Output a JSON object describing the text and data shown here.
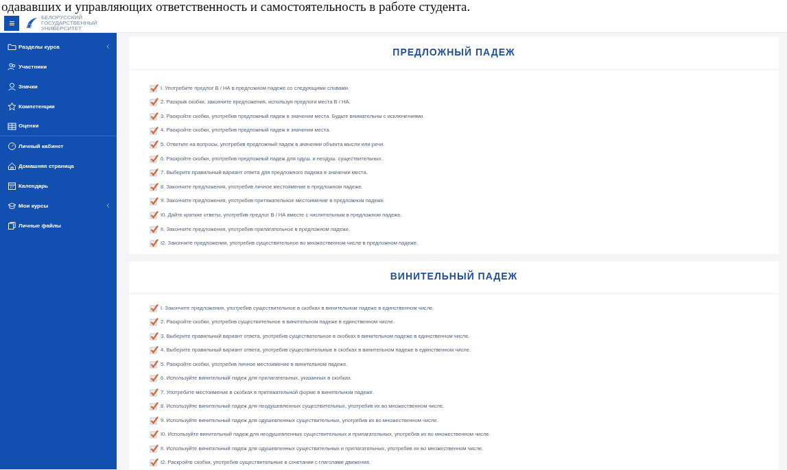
{
  "top_text": "одававших и управляющих ответственность и самостоятельность в работе студента.",
  "header": {
    "menu_glyph": "≡",
    "logo_lines": [
      "БЕЛОРУССКИЙ",
      "ГОСУДАРСТВЕННЫЙ",
      "УНИВЕРСИТЕТ"
    ]
  },
  "sidebar": {
    "items": [
      {
        "label": "Разделы курса",
        "expandable": true,
        "divider_after": false
      },
      {
        "label": "Участники",
        "expandable": false,
        "divider_after": false
      },
      {
        "label": "Значки",
        "expandable": false,
        "divider_after": false
      },
      {
        "label": "Компетенции",
        "expandable": false,
        "divider_after": false
      },
      {
        "label": "Оценки",
        "expandable": false,
        "divider_after": true
      },
      {
        "label": "Личный кабинет",
        "expandable": false,
        "divider_after": false
      },
      {
        "label": "Домашняя страница",
        "expandable": false,
        "divider_after": false
      },
      {
        "label": "Календарь",
        "expandable": false,
        "divider_after": false
      },
      {
        "label": "Мои курсы",
        "expandable": true,
        "divider_after": false
      },
      {
        "label": "Личные файлы",
        "expandable": false,
        "divider_after": false
      }
    ]
  },
  "sections": [
    {
      "title": "ПРЕДЛОЖНЫЙ ПАДЕЖ",
      "items": [
        {
          "text": "I. Употребите предлог В / НА в предложном падеже со следующими словами.",
          "completed": true
        },
        {
          "text": "2. Раскрыв скобки, закончите предложения, используя предлоги места В / НА.",
          "completed": true
        },
        {
          "text": "3. Раскройте скобки, употребив предложный падеж в значении места. Будьте внимательны с исключениями.",
          "completed": true
        },
        {
          "text": "4. Раскройте скобки, употребив предложный падеж в значении места.",
          "completed": true
        },
        {
          "text": "5. Ответьте на вопросы, употребив предложный падеж в значении объекта мысли или речи.",
          "completed": true
        },
        {
          "text": "6. Раскройте скобки, употребив предложный падеж для одуш. и неодуш. существительных.",
          "completed": true
        },
        {
          "text": "7. Выберите правильный вариант ответа для предложного падежа в значении места.",
          "completed": true
        },
        {
          "text": "8. Закончите предложения, употребив личное местоимение в предложном падеже.",
          "completed": true
        },
        {
          "text": "9. Закончите предложения, употребив притяжательное местоимение в предложном падеже.",
          "completed": true
        },
        {
          "text": "I0. Дайте краткие ответы, употребив предлог В / НА вместе с числительным в предложном падеже.",
          "completed": true
        },
        {
          "text": "II. Закончите предложения, употребив прилагательное в предложном падеже.",
          "completed": true
        },
        {
          "text": "I2. Закончите предложения, употребив существительное во множественном числе в предложном падеже.",
          "completed": true
        }
      ]
    },
    {
      "title": "ВИНИТЕЛЬНЫЙ ПАДЕЖ",
      "items": [
        {
          "text": "I. Закончите предложения, употребив существительное в скобках в винительном падеже в единственном числе.",
          "completed": true
        },
        {
          "text": "2. Раскройте скобки, употребив существительное в винительном падеже в единственном числе.",
          "completed": true
        },
        {
          "text": "3. Выберите правильный вариант ответа, употребив существательное в скобках в винительном падеже в единственном числе.",
          "completed": true
        },
        {
          "text": "4. Выберите правильный вариант ответа, употребив существительные в скобках в винительном падеже в единственном числе.",
          "completed": true
        },
        {
          "text": "5. Раскройте скобки, употребив личное местоимение в винительном падеже.",
          "completed": true
        },
        {
          "text": "6. Используйте винительный падеж для прилагательных, указанных в скобках.",
          "completed": true
        },
        {
          "text": "7. Употребите местоимение в скобках в притяжательной форме в винительном падеже.",
          "completed": true
        },
        {
          "text": "8. Используйте винительный падеж для неодушевленных существительных, употребив их во множественном числе.",
          "completed": true
        },
        {
          "text": "9. Используйте винительный падеж для одушевленных существительных, употребив их во множественном числе.",
          "completed": true
        },
        {
          "text": "I0. Используйте винительный падеж для неодушевленных существительных и прилагательных, употребив их во множественном числе.",
          "completed": true
        },
        {
          "text": "II. Используйте винительный падеж для одушевленных существительных и прилагательных, употребив их во множественном числе.",
          "completed": true
        },
        {
          "text": "I2. Раскройте скобки, употребив существительные в сочетании с глаголами движения.",
          "completed": true
        }
      ]
    }
  ]
}
